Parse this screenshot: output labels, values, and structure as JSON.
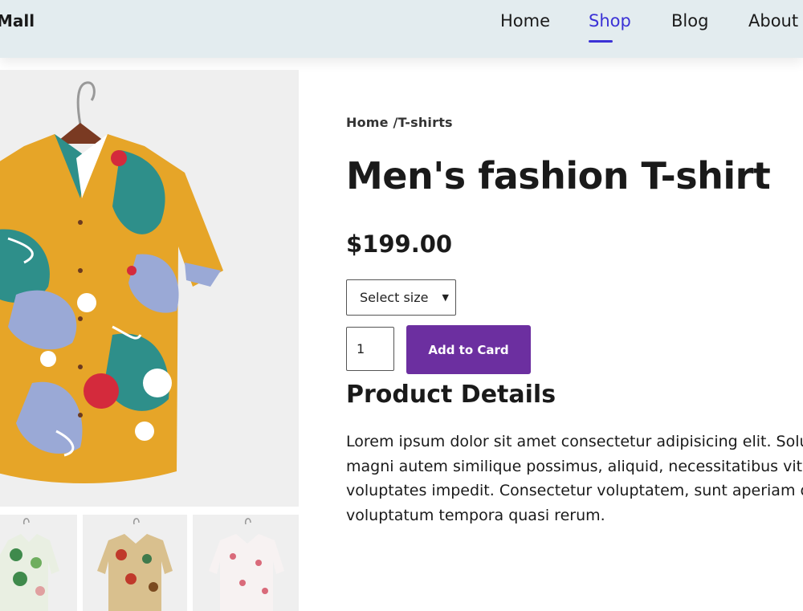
{
  "header": {
    "brand": "Mall",
    "nav": [
      {
        "label": "Home",
        "active": false
      },
      {
        "label": "Shop",
        "active": true
      },
      {
        "label": "Blog",
        "active": false
      },
      {
        "label": "About",
        "active": false
      }
    ]
  },
  "breadcrumb": "Home /T-shirts",
  "product": {
    "title": "Men's fashion T-shirt",
    "price": "$199.00",
    "size_select": {
      "selected": "Select size"
    },
    "quantity": "1",
    "add_button": "Add to Card"
  },
  "details": {
    "heading": "Product Details",
    "lines": [
      "Lorem ipsum dolor sit amet consectetur adipisicing elit. Solu",
      "magni autem similique possimus, aliquid, necessitatibus vita",
      "voluptates impedit. Consectetur voluptatem, sunt aperiam o",
      "voluptatum tempora quasi rerum."
    ]
  },
  "colors": {
    "header_bg": "#e3ecef",
    "accent": "#3b32d6",
    "button": "#6c2fa0"
  },
  "icons": [
    "chevron-down-icon"
  ]
}
